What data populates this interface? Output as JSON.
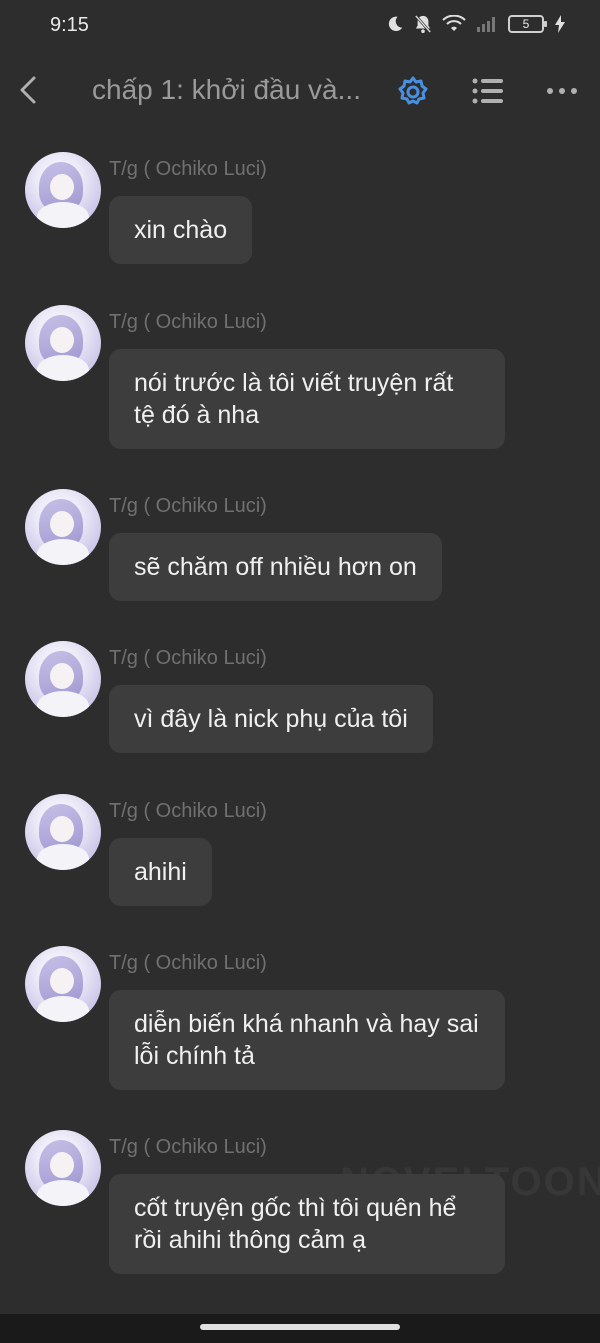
{
  "status_bar": {
    "time": "9:15",
    "battery_level": "5"
  },
  "header": {
    "title": "chấp 1: khởi đầu và..."
  },
  "watermark": "NOVELTOON",
  "messages": [
    {
      "author": "T/g ( Ochiko Luci)",
      "text": "xin chào"
    },
    {
      "author": "T/g ( Ochiko Luci)",
      "text": "nói trước là tôi viết truyện rất tệ đó à nha"
    },
    {
      "author": "T/g ( Ochiko Luci)",
      "text": "sẽ chăm off nhiều hơn on"
    },
    {
      "author": "T/g ( Ochiko Luci)",
      "text": "vì đây là nick phụ của tôi"
    },
    {
      "author": "T/g ( Ochiko Luci)",
      "text": "ahihi"
    },
    {
      "author": "T/g ( Ochiko Luci)",
      "text": "diễn biến khá nhanh và hay sai lỗi chính tả"
    },
    {
      "author": "T/g ( Ochiko Luci)",
      "text": "cốt truyện gốc thì tôi quên hể rồi ahihi thông cảm ạ"
    }
  ],
  "colors": {
    "background": "#2d2d2d",
    "bubble": "#3d3d3d",
    "accent": "#4a90e2"
  }
}
